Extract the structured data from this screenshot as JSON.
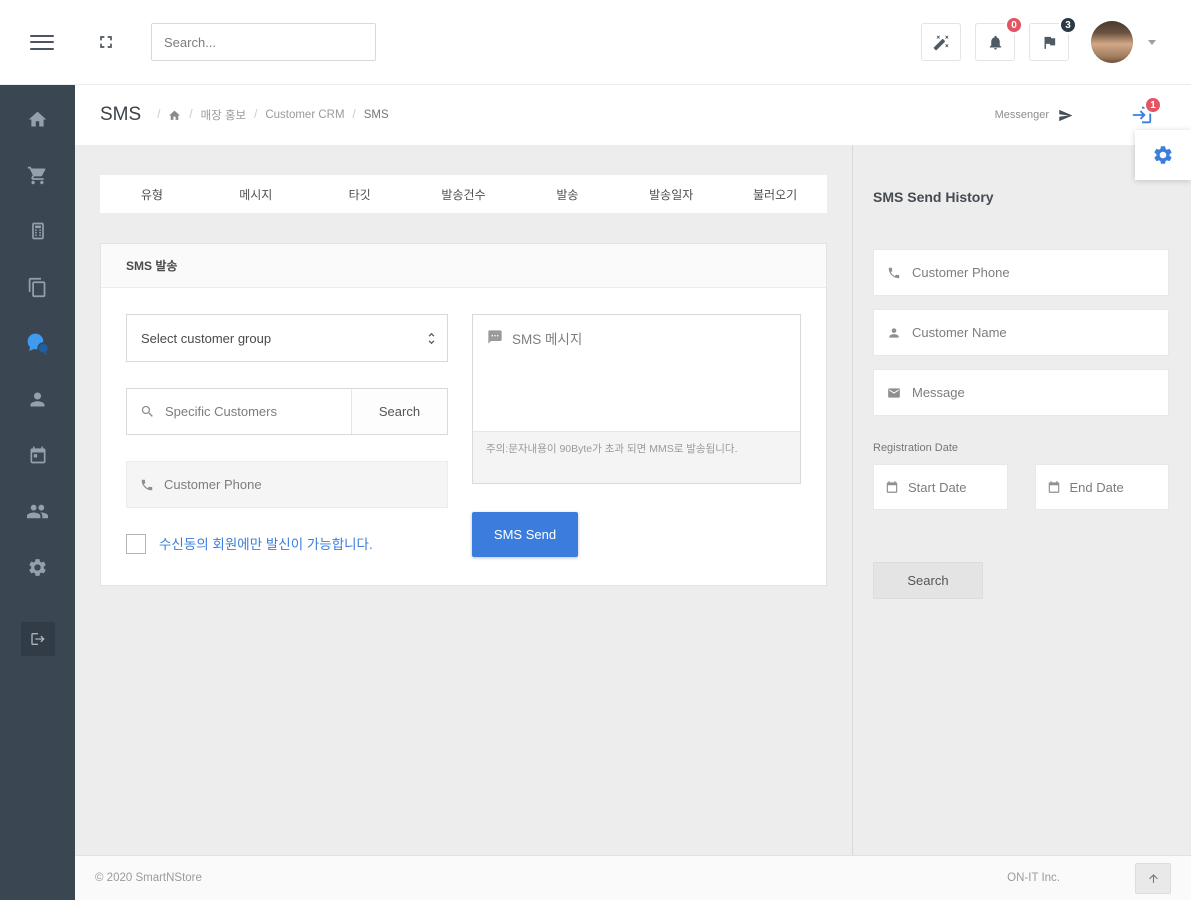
{
  "colors": {
    "accent": "#3b7ddd",
    "sidebar_bg": "#3a4651",
    "badge_red": "#e25563",
    "badge_dark": "#2b3947",
    "content_bg": "#ededed"
  },
  "navbar": {
    "search_placeholder": "Search...",
    "notifications_badge": "0",
    "flag_badge": "3"
  },
  "sidebar": {
    "items": [
      "home-icon",
      "cart-icon",
      "calculator-icon",
      "documents-icon",
      "chat-icon",
      "customer-icon",
      "calendar-icon",
      "users-icon",
      "settings-icon",
      "logout-icon"
    ],
    "active_item": "chat-icon"
  },
  "breadcrumb": {
    "page_title": "SMS",
    "separator": "/",
    "crumbs": [
      "매장 홍보",
      "Customer CRM",
      "SMS"
    ],
    "messenger_label": "Messenger",
    "signin_badge": "1"
  },
  "table_columns": [
    "유형",
    "메시지",
    "타깃",
    "발송건수",
    "발송",
    "발송일자",
    "불러오기"
  ],
  "sms_form": {
    "card_title": "SMS 발송",
    "customer_group_selected": "Select customer group",
    "specific_customers_placeholder": "Specific Customers",
    "search_button_label": "Search",
    "customer_phone_placeholder": "Customer Phone",
    "consent_label": "수신동의 회원에만 발신이 가능합니다.",
    "message_placeholder": "SMS 메시지",
    "byte_notice": "주의:문자내용이 90Byte가 초과 되면 MMS로 발송됩니다.",
    "send_button_label": "SMS Send"
  },
  "history_panel": {
    "title": "SMS Send History",
    "customer_phone_placeholder": "Customer Phone",
    "customer_name_placeholder": "Customer Name",
    "message_placeholder": "Message",
    "registration_date_label": "Registration Date",
    "start_date_placeholder": "Start Date",
    "end_date_placeholder": "End Date",
    "search_button_label": "Search"
  },
  "footer": {
    "copyright": "© 2020 SmartNStore",
    "company": "ON-IT Inc."
  }
}
